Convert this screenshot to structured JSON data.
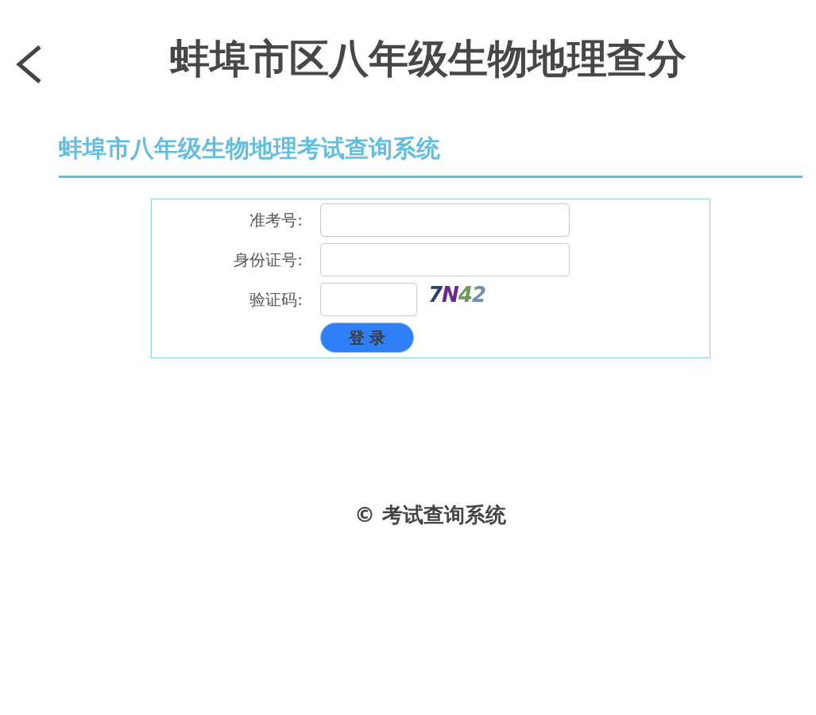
{
  "header": {
    "title": "蚌埠市区八年级生物地理查分"
  },
  "section": {
    "title": "蚌埠市八年级生物地理考试查询系统"
  },
  "form": {
    "fields": [
      {
        "label": "准考号:",
        "kind": "text"
      },
      {
        "label": "身份证号:",
        "kind": "text"
      },
      {
        "label": "验证码:",
        "kind": "captcha"
      }
    ],
    "captcha": [
      {
        "char": "7",
        "color": "#2e3f70"
      },
      {
        "char": "N",
        "color": "#6a2a8c"
      },
      {
        "char": "4",
        "color": "#6f9a5a"
      },
      {
        "char": "2",
        "color": "#6f8fa8"
      }
    ],
    "button": "登 录"
  },
  "footer": "© 考试查询系统"
}
